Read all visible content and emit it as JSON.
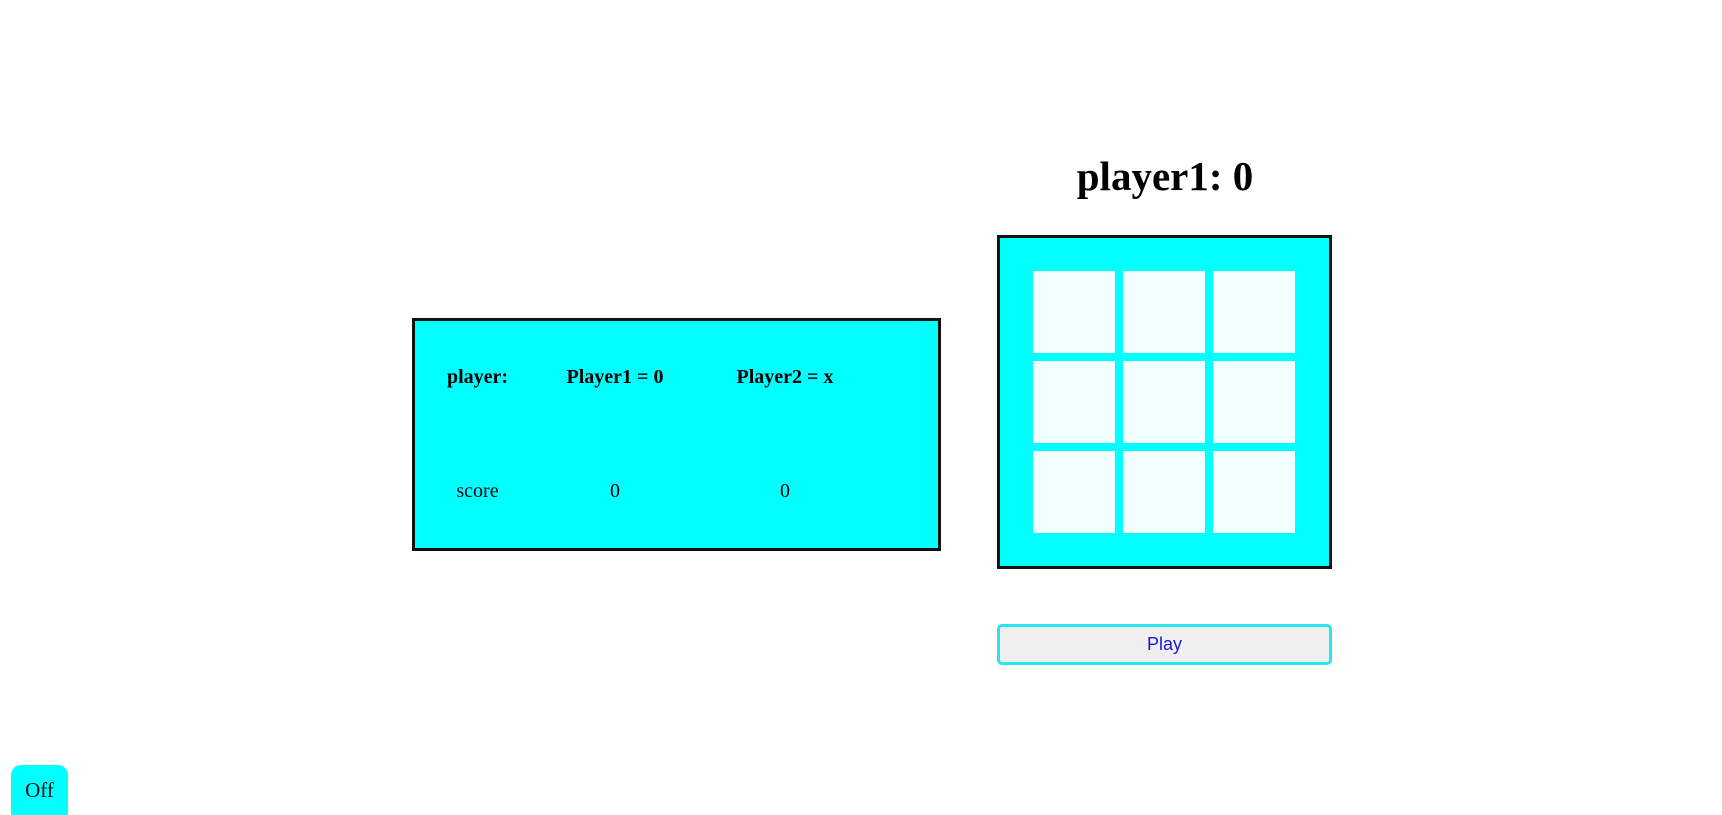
{
  "turn": {
    "heading": "player1: 0"
  },
  "scoreboard": {
    "header": [
      "player:",
      "Player1 = 0",
      "Player2 = x"
    ],
    "row": [
      "score",
      "0",
      "0"
    ]
  },
  "board": {
    "cells": [
      "",
      "",
      "",
      "",
      "",
      "",
      "",
      "",
      ""
    ]
  },
  "controls": {
    "play_label": "Play",
    "off_label": "Off"
  },
  "colors": {
    "panel": "#00ffff",
    "cell": "#f0ffff",
    "play_border": "#26e6f0",
    "play_text": "#1a1acc"
  }
}
